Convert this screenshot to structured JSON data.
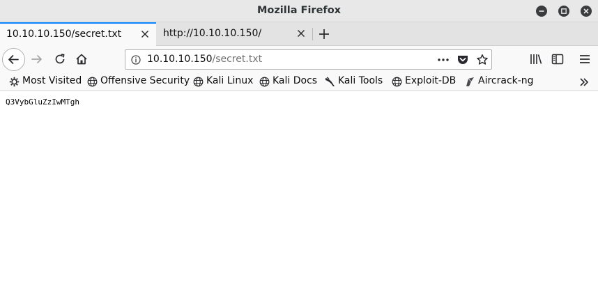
{
  "window": {
    "title": "Mozilla Firefox"
  },
  "tabs": [
    {
      "label": "10.10.10.150/secret.txt",
      "active": true
    },
    {
      "label": "http://10.10.10.150/",
      "active": false
    }
  ],
  "urlbar": {
    "host": "10.10.10.150",
    "path": "/secret.txt"
  },
  "bookmarks": [
    {
      "label": "Most Visited",
      "icon": "gear-icon"
    },
    {
      "label": "Offensive Security",
      "icon": "globe-icon"
    },
    {
      "label": "Kali Linux",
      "icon": "globe-icon"
    },
    {
      "label": "Kali Docs",
      "icon": "globe-icon"
    },
    {
      "label": "Kali Tools",
      "icon": "kali-dragon-icon"
    },
    {
      "label": "Exploit-DB",
      "icon": "globe-icon"
    },
    {
      "label": "Aircrack-ng",
      "icon": "aircrack-icon"
    }
  ],
  "content": {
    "text": "Q3VybGluZzIwMTgh"
  },
  "colors": {
    "accent": "#0a84ff",
    "titlebar": "#e8e8e8",
    "toolbar": "#f9f9fa"
  }
}
